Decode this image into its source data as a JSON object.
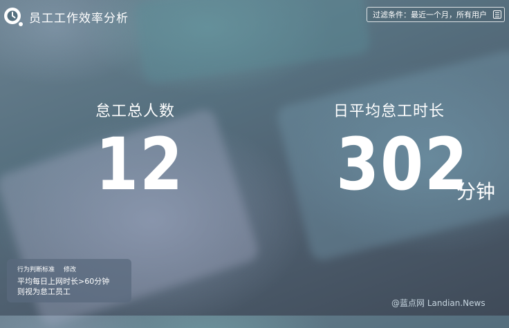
{
  "header": {
    "title": "员工工作效率分析",
    "filter_text": "过滤条件：最近一个月，所有用户",
    "logo_icon": "clock-icon",
    "filter_icon": "menu-icon"
  },
  "stats": [
    {
      "label": "怠工总人数",
      "value": "12",
      "unit": ""
    },
    {
      "label": "日平均怠工时长",
      "value": "302",
      "unit": "分钟"
    }
  ],
  "criteria": {
    "heading": "行为判断标准",
    "edit_label": "修改",
    "rule_line1": "平均每日上网时长>60分钟",
    "rule_line2": "则视为怠工员工"
  },
  "watermark": "@蓝点网 Landian.News"
}
